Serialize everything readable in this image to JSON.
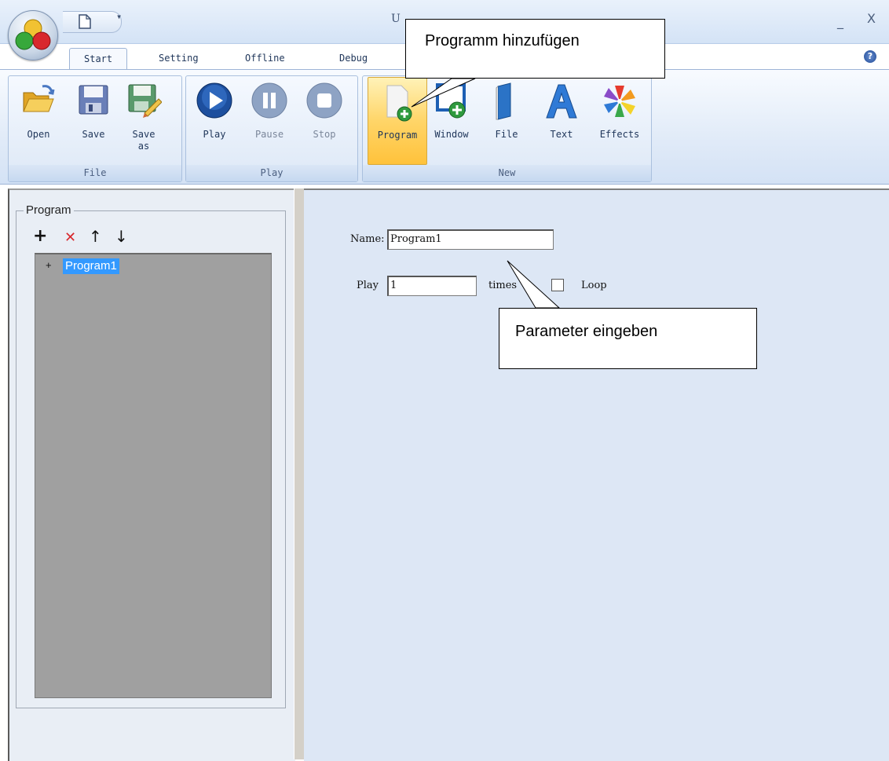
{
  "window": {
    "title": "U",
    "minimize_glyph": "_",
    "close_glyph": "X"
  },
  "quick_access": {
    "dropdown_glyph": "▾"
  },
  "tabs": [
    {
      "label": "Start",
      "active": true
    },
    {
      "label": "Setting"
    },
    {
      "label": "Offline"
    },
    {
      "label": "Debug"
    }
  ],
  "help": {
    "glyph": "?"
  },
  "ribbon": {
    "groups": {
      "file": "File",
      "play": "Play",
      "new": "New"
    },
    "buttons": {
      "open": "Open",
      "save": "Save",
      "save_as": "Save\nas",
      "play": "Play",
      "pause": "Pause",
      "stop": "Stop",
      "program": "Program",
      "window": "Window",
      "file": "File",
      "text": "Text",
      "effects": "Effects"
    }
  },
  "program_panel": {
    "legend": "Program",
    "tools": {
      "add": "+",
      "delete": "✕",
      "up": "↑",
      "down": "↓"
    },
    "tree": {
      "expand": "+",
      "items": [
        "Program1"
      ]
    }
  },
  "form": {
    "name_label": "Name:",
    "name_value": "Program1",
    "play_label": "Play",
    "play_value": "1",
    "times_label": "times",
    "loop_label": "Loop"
  },
  "callouts": {
    "add_program": "Programm hinzufügen",
    "enter_parameters": "Parameter eingeben"
  },
  "colors": {
    "selection": "#3399ff",
    "ribbon_bg": "#dde8f6",
    "tree_bg": "#a0a0a0",
    "right_panel_bg": "#dde7f5"
  }
}
